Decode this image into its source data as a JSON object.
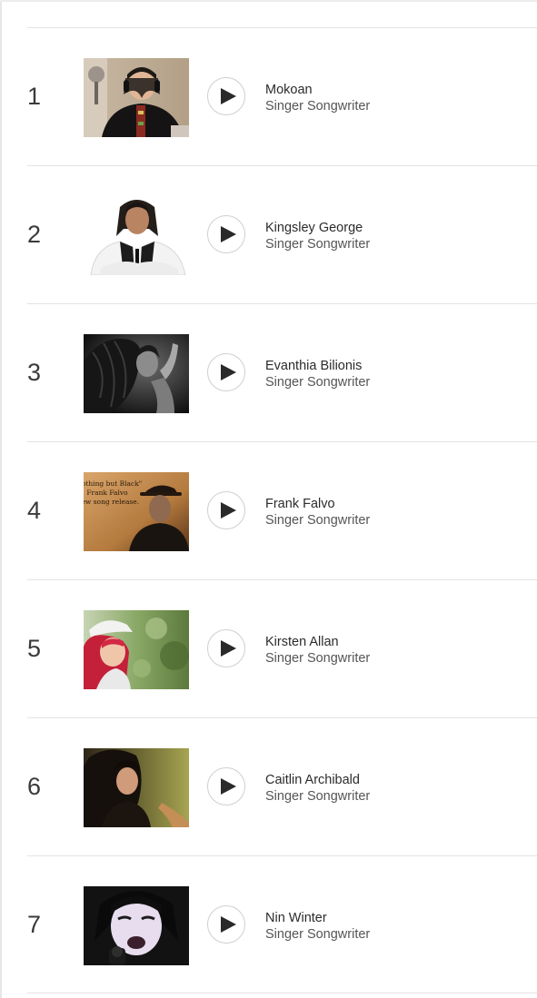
{
  "chart": {
    "entries": [
      {
        "rank": "1",
        "name": "Mokoan",
        "genre": "Singer Songwriter",
        "thumb_alt": "Mokoan photo"
      },
      {
        "rank": "2",
        "name": "Kingsley George",
        "genre": "Singer Songwriter",
        "thumb_alt": "Kingsley George photo"
      },
      {
        "rank": "3",
        "name": "Evanthia Bilionis",
        "genre": "Singer Songwriter",
        "thumb_alt": "Evanthia Bilionis photo"
      },
      {
        "rank": "4",
        "name": "Frank Falvo",
        "genre": "Singer Songwriter",
        "thumb_alt": "Frank Falvo photo",
        "thumb_text": [
          "\"Nothing but Black\"",
          "Frank Falvo",
          "New song release."
        ]
      },
      {
        "rank": "5",
        "name": "Kirsten Allan",
        "genre": "Singer Songwriter",
        "thumb_alt": "Kirsten Allan photo"
      },
      {
        "rank": "6",
        "name": "Caitlin Archibald",
        "genre": "Singer Songwriter",
        "thumb_alt": "Caitlin Archibald photo"
      },
      {
        "rank": "7",
        "name": "Nin Winter",
        "genre": "Singer Songwriter",
        "thumb_alt": "Nin Winter photo"
      }
    ]
  },
  "icons": {
    "play": "play-icon"
  },
  "colors": {
    "text": "#2b2b2b",
    "secondary_text": "#555555",
    "divider": "#e3e3e3",
    "play_icon": "#2a2a2a"
  }
}
